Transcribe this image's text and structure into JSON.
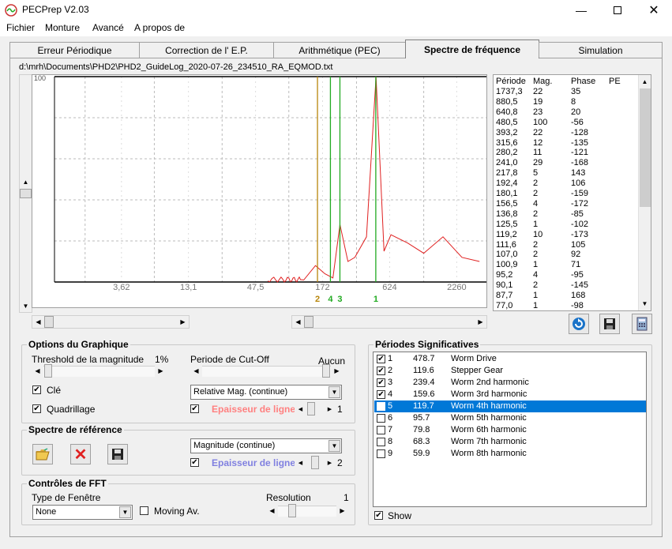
{
  "window": {
    "title": "PECPrep V2.03"
  },
  "menu": [
    "Fichier",
    "Monture",
    "Avancé",
    "A propos de"
  ],
  "tabs": [
    "Erreur Périodique",
    "Correction de l' E.P.",
    "Arithmétique (PEC)",
    "Spectre de fréquence",
    "Simulation"
  ],
  "active_tab": "Spectre de fréquence",
  "file_path": "d:\\mrh\\Documents\\PHD2\\PHD2_GuideLog_2020-07-26_234510_RA_EQMOD.txt",
  "chart_data": {
    "type": "line",
    "title": "",
    "xlabel": "",
    "ylabel": "",
    "x_scale": "log (period)",
    "y_top_label": "100",
    "x_tick_labels": [
      "3,62",
      "13,1",
      "47,5",
      "172",
      "624",
      "2260"
    ],
    "grid": true,
    "markers": [
      {
        "label": "2",
        "period": 156,
        "color": "#b8860b"
      },
      {
        "label": "4",
        "period": 200,
        "color": "#22aa22"
      },
      {
        "label": "3",
        "period": 240,
        "color": "#22aa22"
      },
      {
        "label": "1",
        "period": 478,
        "color": "#22aa22"
      }
    ],
    "series": [
      {
        "values_period_mag": [
          [
            120,
            1
          ],
          [
            150,
            8
          ],
          [
            180,
            4
          ],
          [
            210,
            2
          ],
          [
            240,
            28
          ],
          [
            280,
            10
          ],
          [
            320,
            12
          ],
          [
            400,
            22
          ],
          [
            480,
            100
          ],
          [
            560,
            15
          ],
          [
            640,
            23
          ],
          [
            880,
            19
          ],
          [
            1200,
            14
          ],
          [
            1737,
            22
          ],
          [
            2500,
            12
          ],
          [
            3500,
            10
          ]
        ]
      }
    ]
  },
  "peak_list": {
    "headers": [
      "Période",
      "Mag.",
      "Phase",
      "PE"
    ],
    "rows": [
      [
        "1737,3",
        "22",
        "35"
      ],
      [
        "880,5",
        "19",
        "8"
      ],
      [
        "640,8",
        "23",
        "20"
      ],
      [
        "480,5",
        "100",
        "-56"
      ],
      [
        "393,2",
        "22",
        "-128"
      ],
      [
        "315,6",
        "12",
        "-135"
      ],
      [
        "280,2",
        "11",
        "-121"
      ],
      [
        "241,0",
        "29",
        "-168"
      ],
      [
        "217,8",
        "5",
        "143"
      ],
      [
        "192,4",
        "2",
        "106"
      ],
      [
        "180,1",
        "2",
        "-159"
      ],
      [
        "156,5",
        "4",
        "-172"
      ],
      [
        "136,8",
        "2",
        "-85"
      ],
      [
        "125,5",
        "1",
        "-102"
      ],
      [
        "119,2",
        "10",
        "-173"
      ],
      [
        "111,6",
        "2",
        "105"
      ],
      [
        "107,0",
        "2",
        "92"
      ],
      [
        "100,9",
        "1",
        "71"
      ],
      [
        "95,2",
        "4",
        "-95"
      ],
      [
        "90,1",
        "2",
        "-145"
      ],
      [
        "87,7",
        "1",
        "168"
      ],
      [
        "77,0",
        "1",
        "-98"
      ]
    ]
  },
  "options": {
    "title": "Options du Graphique",
    "threshold_label": "Threshold de la magnitude",
    "threshold_value": "1%",
    "cutoff_label": "Periode de Cut-Off",
    "cutoff_value": "Aucun",
    "cle_label": "Clé",
    "grid_label": "Quadrillage",
    "display_mode": "Relative Mag. (continue)",
    "line_width_label": "Epaisseur de ligne",
    "line_width_value": "1",
    "line_width_color": "#ff8080"
  },
  "reference": {
    "title": "Spectre de référence",
    "mode": "Magnitude (continue)",
    "line_width_label": "Epaisseur de ligne",
    "line_width_value": "2",
    "line_width_color": "#8080e0"
  },
  "fft": {
    "title": "Contrôles de FFT",
    "window_label": "Type de Fenêtre",
    "window_value": "None",
    "moving_av_label": "Moving Av.",
    "resolution_label": "Resolution",
    "resolution_value": "1"
  },
  "significant": {
    "title": "Périodes Significatives",
    "show_label": "Show",
    "rows": [
      {
        "n": "1",
        "period": "478.7",
        "name": "Worm Drive",
        "checked": true
      },
      {
        "n": "2",
        "period": "119.6",
        "name": "Stepper Gear",
        "checked": true
      },
      {
        "n": "3",
        "period": "239.4",
        "name": "Worm 2nd harmonic",
        "checked": true
      },
      {
        "n": "4",
        "period": "159.6",
        "name": "Worm 3rd harmonic",
        "checked": true
      },
      {
        "n": "5",
        "period": "119.7",
        "name": "Worm 4th harmonic",
        "checked": false,
        "selected": true
      },
      {
        "n": "6",
        "period": "95.7",
        "name": "Worm 5th harmonic",
        "checked": false
      },
      {
        "n": "7",
        "period": "79.8",
        "name": "Worm 6th harmonic",
        "checked": false
      },
      {
        "n": "8",
        "period": "68.3",
        "name": "Worm 7th harmonic",
        "checked": false
      },
      {
        "n": "9",
        "period": "59.9",
        "name": "Worm 8th harmonic",
        "checked": false
      }
    ]
  }
}
